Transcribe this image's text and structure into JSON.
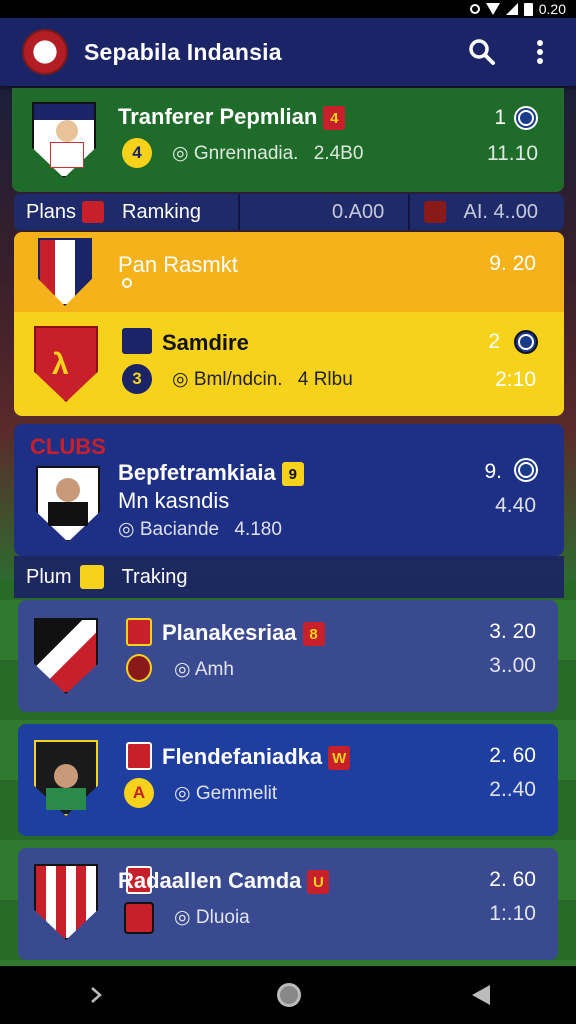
{
  "status": {
    "time": "0.20"
  },
  "app": {
    "title": "Sepabila Indansia",
    "search_icon": "search-icon",
    "menu_icon": "more-vert-icon"
  },
  "transfer": {
    "title": "Tranferer Pepmlian",
    "badge": "4",
    "subtitle": "Gnrennadia.",
    "sub_value": "2.4B0",
    "rank": "1",
    "value": "11.10",
    "circle_glyph": "4"
  },
  "ranking_bar_1": {
    "left_label": "Plans",
    "right_label": "Ramking",
    "value1": "0.A00",
    "value2": "AI. 4..00"
  },
  "yellow_top": {
    "title": "Pan Rasmkt",
    "value": "9. 20"
  },
  "yellow_main": {
    "title": "Samdire",
    "rank": "2",
    "subtitle": "Bml/ndcin.",
    "sub_value": "4 Rlbu",
    "value": "2:10",
    "circle_glyph": "3"
  },
  "clubs": {
    "header": "CLUBS",
    "title": "Bepfetramkiaia",
    "badge": "9",
    "second_line": "Mn kasndis",
    "subtitle": "Baciande",
    "sub_value": "4.180",
    "rank": "9.",
    "value": "4.40"
  },
  "ranking_bar_2": {
    "left_label": "Plum",
    "right_label": "Traking"
  },
  "items": [
    {
      "title": "Planakesriaa",
      "badge": "8",
      "subtitle": "Amh",
      "value1": "3. 20",
      "value2": "3..00"
    },
    {
      "title": "Flendefaniadka",
      "badge": "W",
      "subtitle": "Gemmelit",
      "value1": "2. 60",
      "value2": "2..40",
      "circle_glyph": "A"
    },
    {
      "title": "Radaallen Camda",
      "badge": "U",
      "subtitle": "Dluoia",
      "value1": "2. 60",
      "value2": "1:.10"
    }
  ],
  "colors": {
    "appbar": "#1b2466",
    "green_card": "#1f6b2a",
    "yellow": "#f7c21a",
    "navy": "#1e2f86",
    "badge_red": "#c8202a",
    "badge_yellow": "#f7d21a"
  }
}
